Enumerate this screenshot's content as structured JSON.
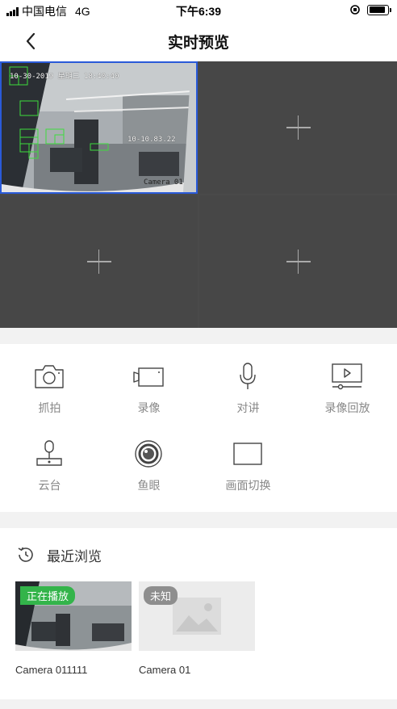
{
  "status_bar": {
    "carrier": "中国电信",
    "network": "4G",
    "time": "下午6:39",
    "battery_level": 0.9
  },
  "nav": {
    "title": "实时预览",
    "back_icon": "chevron-left-icon"
  },
  "preview_grid": {
    "active_cell": 1,
    "camera_1": {
      "timestamp": "10-30-2019 星期三 18:40:40",
      "ip_overlay": "10-10.83.22",
      "name_overlay": "Camera 01"
    },
    "empty_cell_icon": "plus-icon"
  },
  "tools": [
    {
      "label": "抓拍",
      "icon": "camera-icon"
    },
    {
      "label": "录像",
      "icon": "video-camera-icon"
    },
    {
      "label": "对讲",
      "icon": "microphone-icon"
    },
    {
      "label": "录像回放",
      "icon": "playback-icon"
    },
    {
      "label": "云台",
      "icon": "joystick-icon"
    },
    {
      "label": "鱼眼",
      "icon": "fisheye-icon"
    },
    {
      "label": "画面切换",
      "icon": "screen-switch-icon"
    }
  ],
  "recent": {
    "title": "最近浏览",
    "icon": "history-icon",
    "items": [
      {
        "name": "Camera 011111",
        "badge": "正在播放",
        "badge_color": "#33b44a"
      },
      {
        "name": "Camera 01",
        "badge": "未知",
        "badge_color": "#8e8e8e"
      }
    ]
  },
  "colors": {
    "accent_border": "#2a5ad8",
    "grid_bg": "#474747",
    "live_badge": "#33b44a"
  }
}
